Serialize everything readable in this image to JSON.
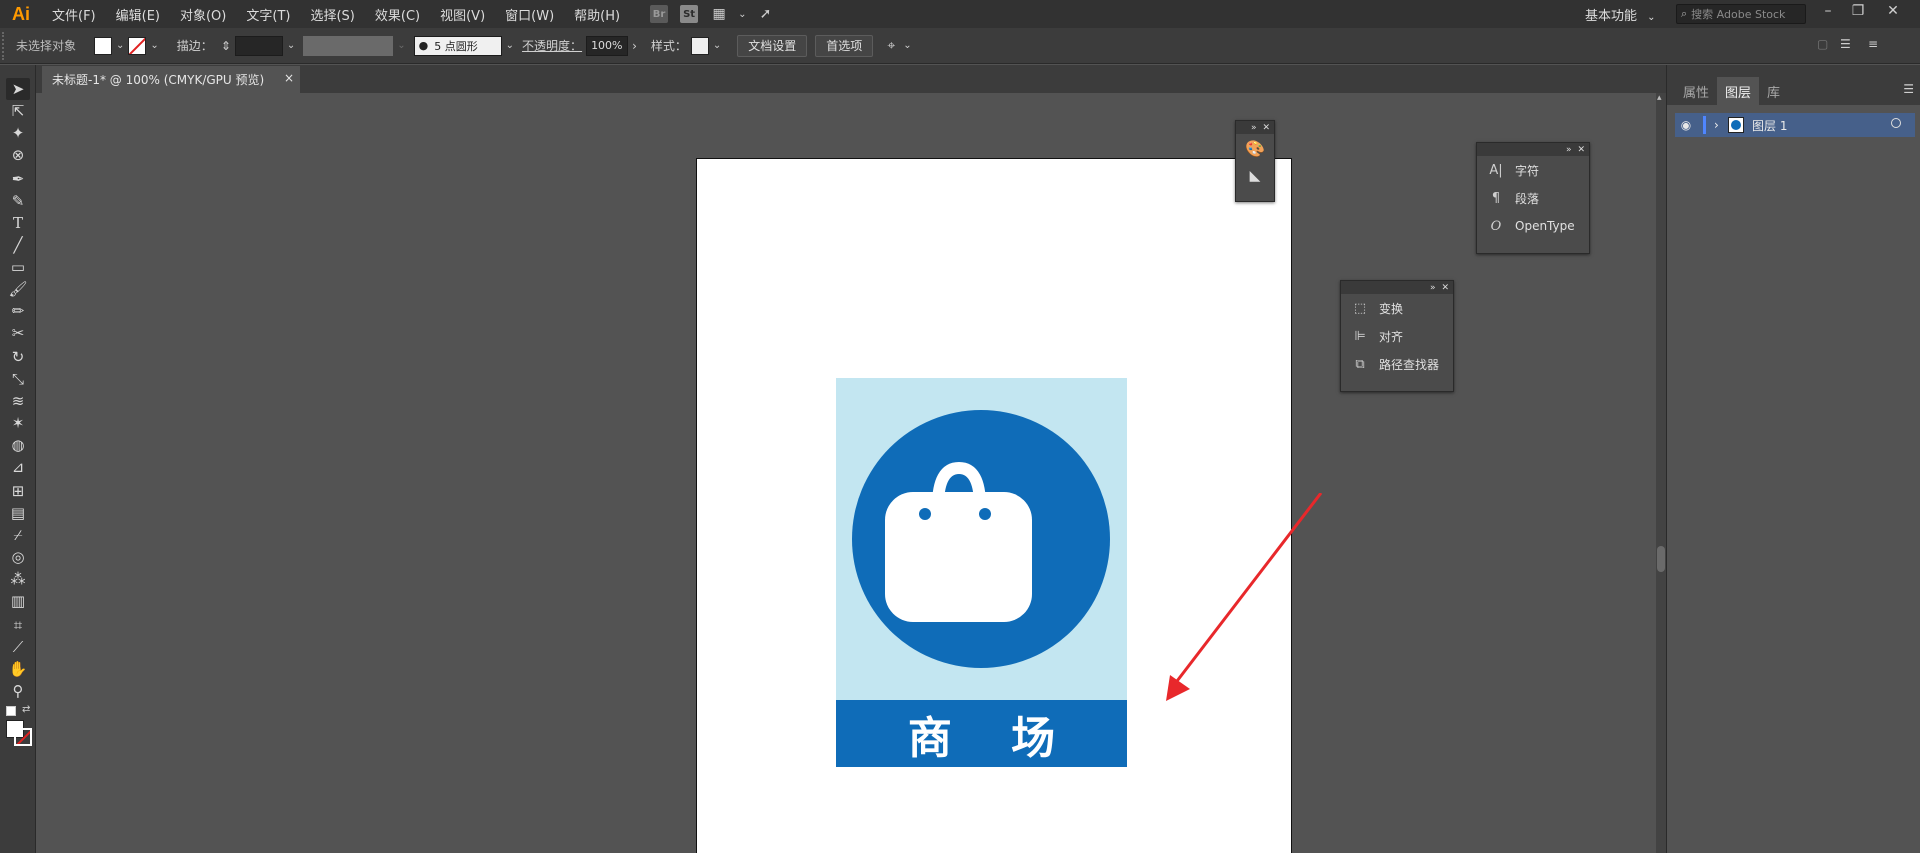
{
  "app": {
    "logo": "Ai",
    "accent_color": "#ff9a00"
  },
  "menu": [
    "文件(F)",
    "编辑(E)",
    "对象(O)",
    "文字(T)",
    "选择(S)",
    "效果(C)",
    "视图(V)",
    "窗口(W)",
    "帮助(H)"
  ],
  "menubar_icons": {
    "bridge": "Br",
    "stock": "St"
  },
  "workspace": {
    "label": "基本功能"
  },
  "search": {
    "placeholder": "搜索 Adobe Stock"
  },
  "control": {
    "selection_status": "未选择对象",
    "stroke_label": "描边：",
    "brush_value": "5 点圆形",
    "opacity_label": "不透明度：",
    "opacity_value": "100%",
    "style_label": "样式：",
    "doc_setup_label": "文档设置",
    "preferences_label": "首选项"
  },
  "document": {
    "tab_title": "未标题-1* @ 100% (CMYK/GPU 预览)",
    "close_glyph": "×"
  },
  "artwork": {
    "sign_text": "商 场",
    "light_blue": "#c3e6f1",
    "dark_blue": "#0f6cb8",
    "arrow_color": "#e8282b"
  },
  "panel_type": {
    "items": [
      "字符",
      "段落",
      "OpenType"
    ]
  },
  "panel_transform": {
    "items": [
      "变换",
      "对齐",
      "路径查找器"
    ]
  },
  "right_panel": {
    "tabs": [
      "属性",
      "图层",
      "库"
    ],
    "active_tab": "图层",
    "layer_name": "图层 1",
    "layer_color": "#46608a"
  }
}
